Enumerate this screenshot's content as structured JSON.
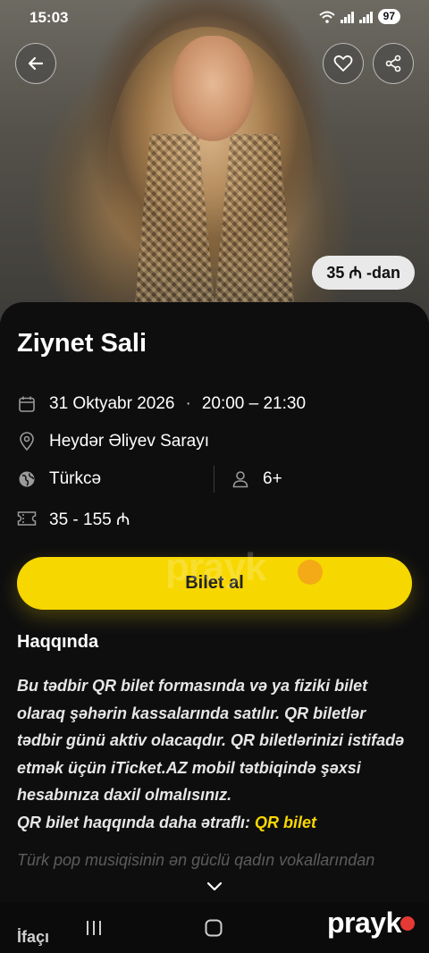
{
  "status_bar": {
    "time": "15:03",
    "battery": "97"
  },
  "hero": {
    "price_pill": "35 ₼ -dan"
  },
  "event": {
    "title": "Ziynet Sali",
    "date": "31 Oktyabr 2026",
    "separator": "·",
    "time_range": "20:00 – 21:30",
    "venue": "Heydər Əliyev Sarayı",
    "language": "Türkcə",
    "age": "6+",
    "price_range": "35 - 155 ₼"
  },
  "cta": {
    "label": "Bilet al"
  },
  "watermark": {
    "text": "prayk"
  },
  "about": {
    "heading": "Haqqında",
    "body": "Bu tədbir QR bilet formasında və ya fiziki bilet olaraq şəhərin kassalarında satılır. QR biletlər tədbir günü aktiv olacaqdır. QR biletlərinizi istifadə etmək üçün iTicket.AZ mobil tətbiqində şəxsi hesabınıza daxil olmalısınız.",
    "more_prefix": "QR bilet haqqında daha ətraflı:",
    "more_link": "QR bilet",
    "faded_preview": "Türk pop musiqisinin ən güclü qadın vokallarından"
  },
  "next_section": {
    "label": "İfaçı"
  },
  "brand": {
    "text": "prayk"
  },
  "colors": {
    "accent": "#f7d700",
    "background": "#0e0e0f",
    "brand_dot": "#e53935"
  },
  "icons": [
    "back-arrow-icon",
    "heart-icon",
    "share-icon",
    "calendar-icon",
    "location-pin-icon",
    "globe-icon",
    "person-icon",
    "ticket-icon",
    "chevron-down-icon",
    "recents-icon",
    "home-icon"
  ]
}
